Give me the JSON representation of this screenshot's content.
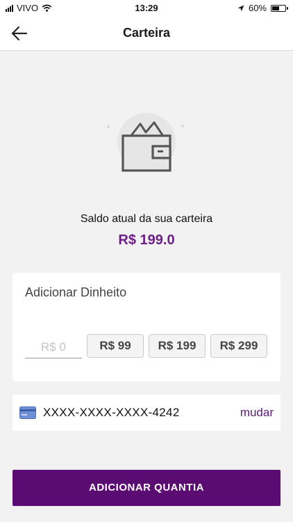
{
  "status_bar": {
    "carrier": "VIVO",
    "time": "13:29",
    "battery_percent": "60%",
    "battery_level": 0.6
  },
  "header": {
    "title": "Carteira",
    "back_icon": "arrow-left-icon"
  },
  "wallet": {
    "icon": "wallet-icon",
    "balance_label": "Saldo atual da sua carteira",
    "balance_value": "R$ 199.0"
  },
  "add_money": {
    "title": "Adicionar Dinheito",
    "input_placeholder": "R$ 0",
    "presets": [
      "R$ 99",
      "R$ 199",
      "R$ 299"
    ]
  },
  "payment": {
    "card_icon": "credit-card-icon",
    "card_number": "XXXX-XXXX-XXXX-4242",
    "change_label": "mudar"
  },
  "primary_action": {
    "label": "ADICIONAR QUANTIA"
  },
  "colors": {
    "accent": "#5b0c72",
    "balance": "#6b1f85",
    "background": "#f2f2f2"
  }
}
